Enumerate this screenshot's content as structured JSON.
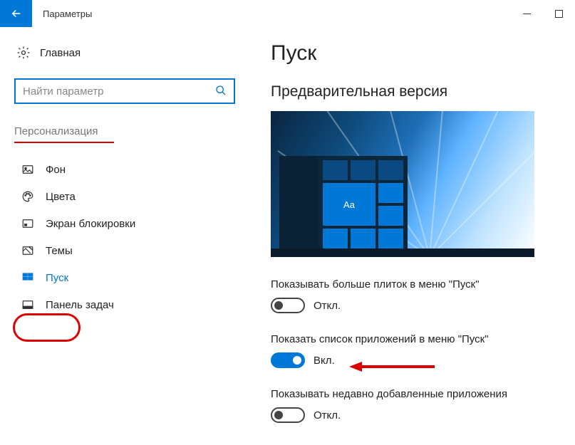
{
  "window": {
    "title": "Параметры"
  },
  "sidebar": {
    "home": "Главная",
    "search_placeholder": "Найти параметр",
    "section": "Персонализация",
    "items": [
      {
        "label": "Фон"
      },
      {
        "label": "Цвета"
      },
      {
        "label": "Экран блокировки"
      },
      {
        "label": "Темы"
      },
      {
        "label": "Пуск"
      },
      {
        "label": "Панель задач"
      }
    ]
  },
  "content": {
    "title": "Пуск",
    "subtitle": "Предварительная версия",
    "preview_tile": "Aa",
    "settings": [
      {
        "label": "Показывать больше плиток в меню \"Пуск\"",
        "state": "Откл.",
        "on": false
      },
      {
        "label": "Показать список приложений в меню \"Пуск\"",
        "state": "Вкл.",
        "on": true
      },
      {
        "label": "Показывать недавно добавленные приложения",
        "state": "Откл.",
        "on": false
      }
    ]
  }
}
